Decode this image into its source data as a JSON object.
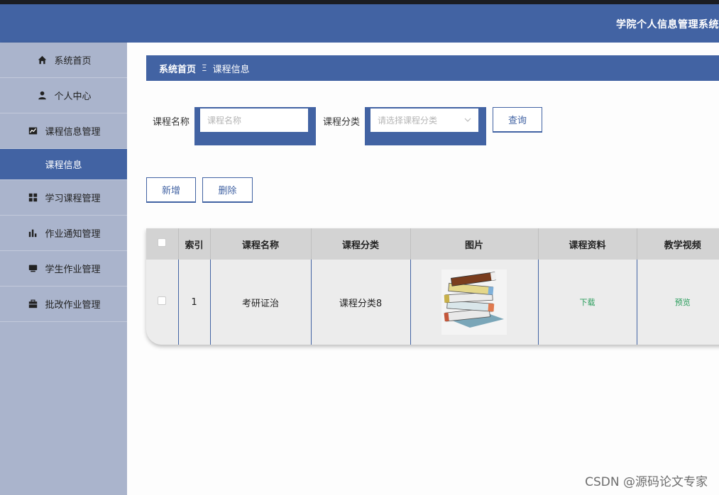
{
  "header": {
    "app_title": "学院个人信息管理系统"
  },
  "sidebar": {
    "items": [
      {
        "label": "系统首页",
        "icon": "home-icon"
      },
      {
        "label": "个人中心",
        "icon": "user-icon"
      },
      {
        "label": "课程信息管理",
        "icon": "chart-icon"
      },
      {
        "label": "课程信息",
        "active": true
      },
      {
        "label": "学习课程管理",
        "icon": "grid-icon"
      },
      {
        "label": "作业通知管理",
        "icon": "bar-chart-icon"
      },
      {
        "label": "学生作业管理",
        "icon": "monitor-icon"
      },
      {
        "label": "批改作业管理",
        "icon": "briefcase-icon"
      }
    ]
  },
  "breadcrumb": {
    "home": "系统首页",
    "separator": "Ξ",
    "current": "课程信息"
  },
  "search": {
    "name_label": "课程名称",
    "name_placeholder": "课程名称",
    "category_label": "课程分类",
    "category_placeholder": "请选择课程分类",
    "query_button": "查询"
  },
  "actions": {
    "add_button": "新增",
    "delete_button": "删除"
  },
  "table": {
    "headers": [
      "索引",
      "课程名称",
      "课程分类",
      "图片",
      "课程资料",
      "教学视频"
    ],
    "rows": [
      {
        "index": "1",
        "name": "考研证治",
        "category": "课程分类8",
        "image": "books-image",
        "material": "下载",
        "video": "预览"
      }
    ]
  },
  "watermark": "CSDN @源码论文专家",
  "colors": {
    "primary": "#4263a3",
    "sidebar": "#aab4cc",
    "link": "#2a9d5c"
  }
}
